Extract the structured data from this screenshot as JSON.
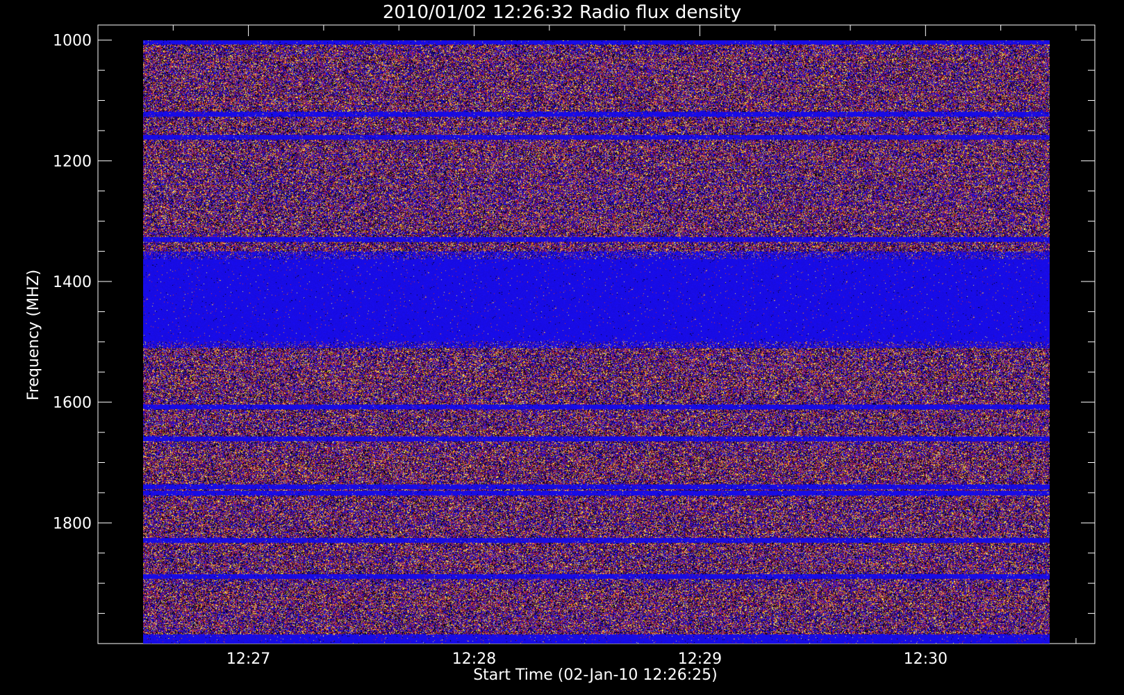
{
  "chart_data": {
    "type": "heatmap",
    "title": "2010/01/02 12:26:32 Radio flux density",
    "xlabel": "Start Time (02-Jan-10 12:26:25)",
    "ylabel": "Frequency (MHZ)",
    "x_tick_labels": [
      "12:27",
      "12:28",
      "12:29",
      "12:30"
    ],
    "x_tick_values_sec": [
      35,
      95,
      155,
      215
    ],
    "x_minor_step_sec": 20,
    "xlim_sec": [
      -5,
      260
    ],
    "data_xlim_sec": [
      7,
      248
    ],
    "y_tick_labels": [
      "1000",
      "1200",
      "1400",
      "1600",
      "1800"
    ],
    "y_tick_values": [
      1000,
      1200,
      1400,
      1600,
      1800
    ],
    "y_minor_step": 50,
    "ylim": [
      975,
      2000
    ],
    "data_ylim": [
      1000,
      2000
    ],
    "y_reversed": true,
    "quiet_band_mhz": [
      1350,
      1510
    ],
    "dim_lines_mhz": [
      1122,
      1160,
      1330,
      1607,
      1660,
      1740,
      1750,
      1828,
      1888,
      1992
    ],
    "colors": {
      "background": "#000000",
      "axis": "#ffffff",
      "base": "#1a0df2",
      "noise_palette": [
        "#000000",
        "#3a0a6e",
        "#8a1060",
        "#c02040",
        "#e04030",
        "#f0a020",
        "#ffff60"
      ]
    }
  }
}
